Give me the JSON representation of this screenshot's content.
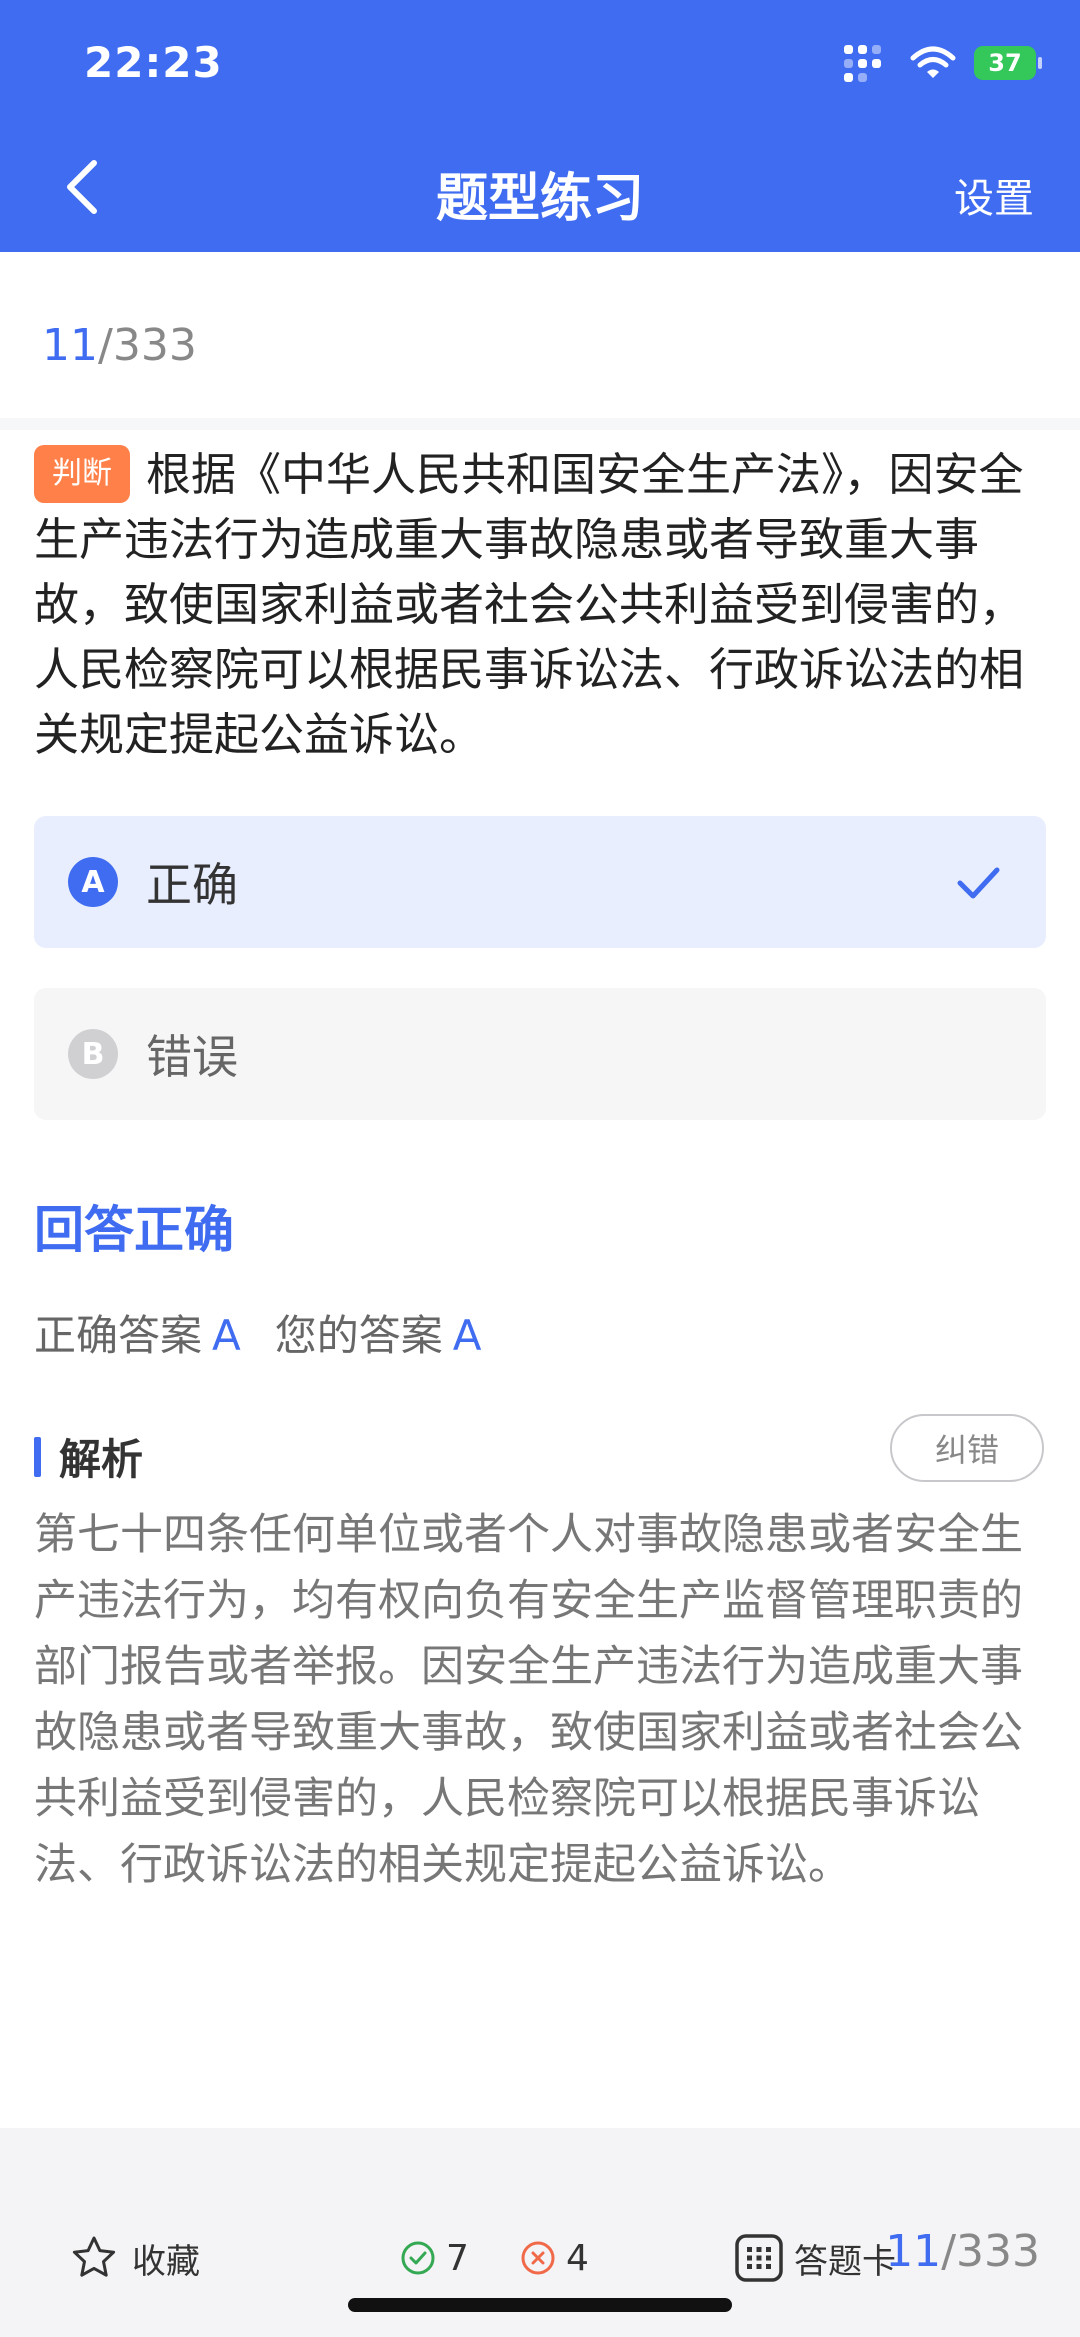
{
  "status": {
    "time": "22:23",
    "battery": "37"
  },
  "nav": {
    "title": "题型练习",
    "settings": "设置",
    "back_icon": "chevron-left-icon"
  },
  "progress": {
    "current": "11",
    "total": "/333"
  },
  "question": {
    "tag": "判断",
    "text": "根据《中华人民共和国安全生产法》，因安全生产违法行为造成重大事故隐患或者导致重大事故，致使国家利益或者社会公共利益受到侵害的，人民检察院可以根据民事诉讼法、行政诉讼法的相关规定提起公益诉讼。"
  },
  "options": [
    {
      "letter": "A",
      "text": "正确",
      "selected": true
    },
    {
      "letter": "B",
      "text": "错误",
      "selected": false
    }
  ],
  "result": {
    "status": "回答正确",
    "correct_label": "正确答案",
    "correct_value": "A",
    "yours_label": "您的答案",
    "yours_value": "A"
  },
  "analysis": {
    "title": "解析",
    "correction_button": "纠错",
    "text": "第七十四条任何单位或者个人对事故隐患或者安全生产违法行为，均有权向负有安全生产监督管理职责的部门报告或者举报。因安全生产违法行为造成重大事故隐患或者导致重大事故，致使国家利益或者社会公共利益受到侵害的，人民检察院可以根据民事诉讼法、行政诉讼法的相关规定提起公益诉讼。"
  },
  "bottom": {
    "favorite": "收藏",
    "right_count": "7",
    "wrong_count": "4",
    "answer_card": "答题卡",
    "current": "11",
    "total": "/333"
  },
  "colors": {
    "primary": "#3f6cf0",
    "tag": "#ff8048",
    "success": "#34a853",
    "error": "#f06a4a"
  }
}
